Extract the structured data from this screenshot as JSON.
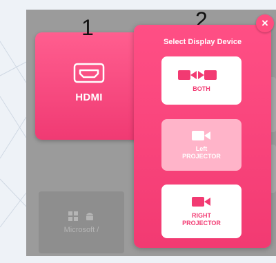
{
  "annotations": {
    "marker_1": "1",
    "marker_2": "2"
  },
  "hdmi": {
    "label": "HDMI",
    "icon": "hdmi-port-icon"
  },
  "device_panel": {
    "title": "Select Display Device",
    "options": [
      {
        "line1": "BOTH",
        "line2": "",
        "icon": "dual-camera-icon",
        "selected": false
      },
      {
        "line1": "Left",
        "line2": "PROJECTOR",
        "icon": "camera-icon",
        "selected": true
      },
      {
        "line1": "RIGHT",
        "line2": "PROJECTOR",
        "icon": "camera-icon",
        "selected": false
      }
    ]
  },
  "close": {
    "glyph": "×",
    "icon": "close-icon"
  },
  "background_tile": {
    "label": "Microsoft /",
    "icons": [
      "windows-icon",
      "android-icon"
    ]
  },
  "colors": {
    "accent": "#f23a72",
    "accent_light": "#ffb4c9",
    "overlay": "#9b9b9b",
    "page_bg": "#eef2f7"
  }
}
